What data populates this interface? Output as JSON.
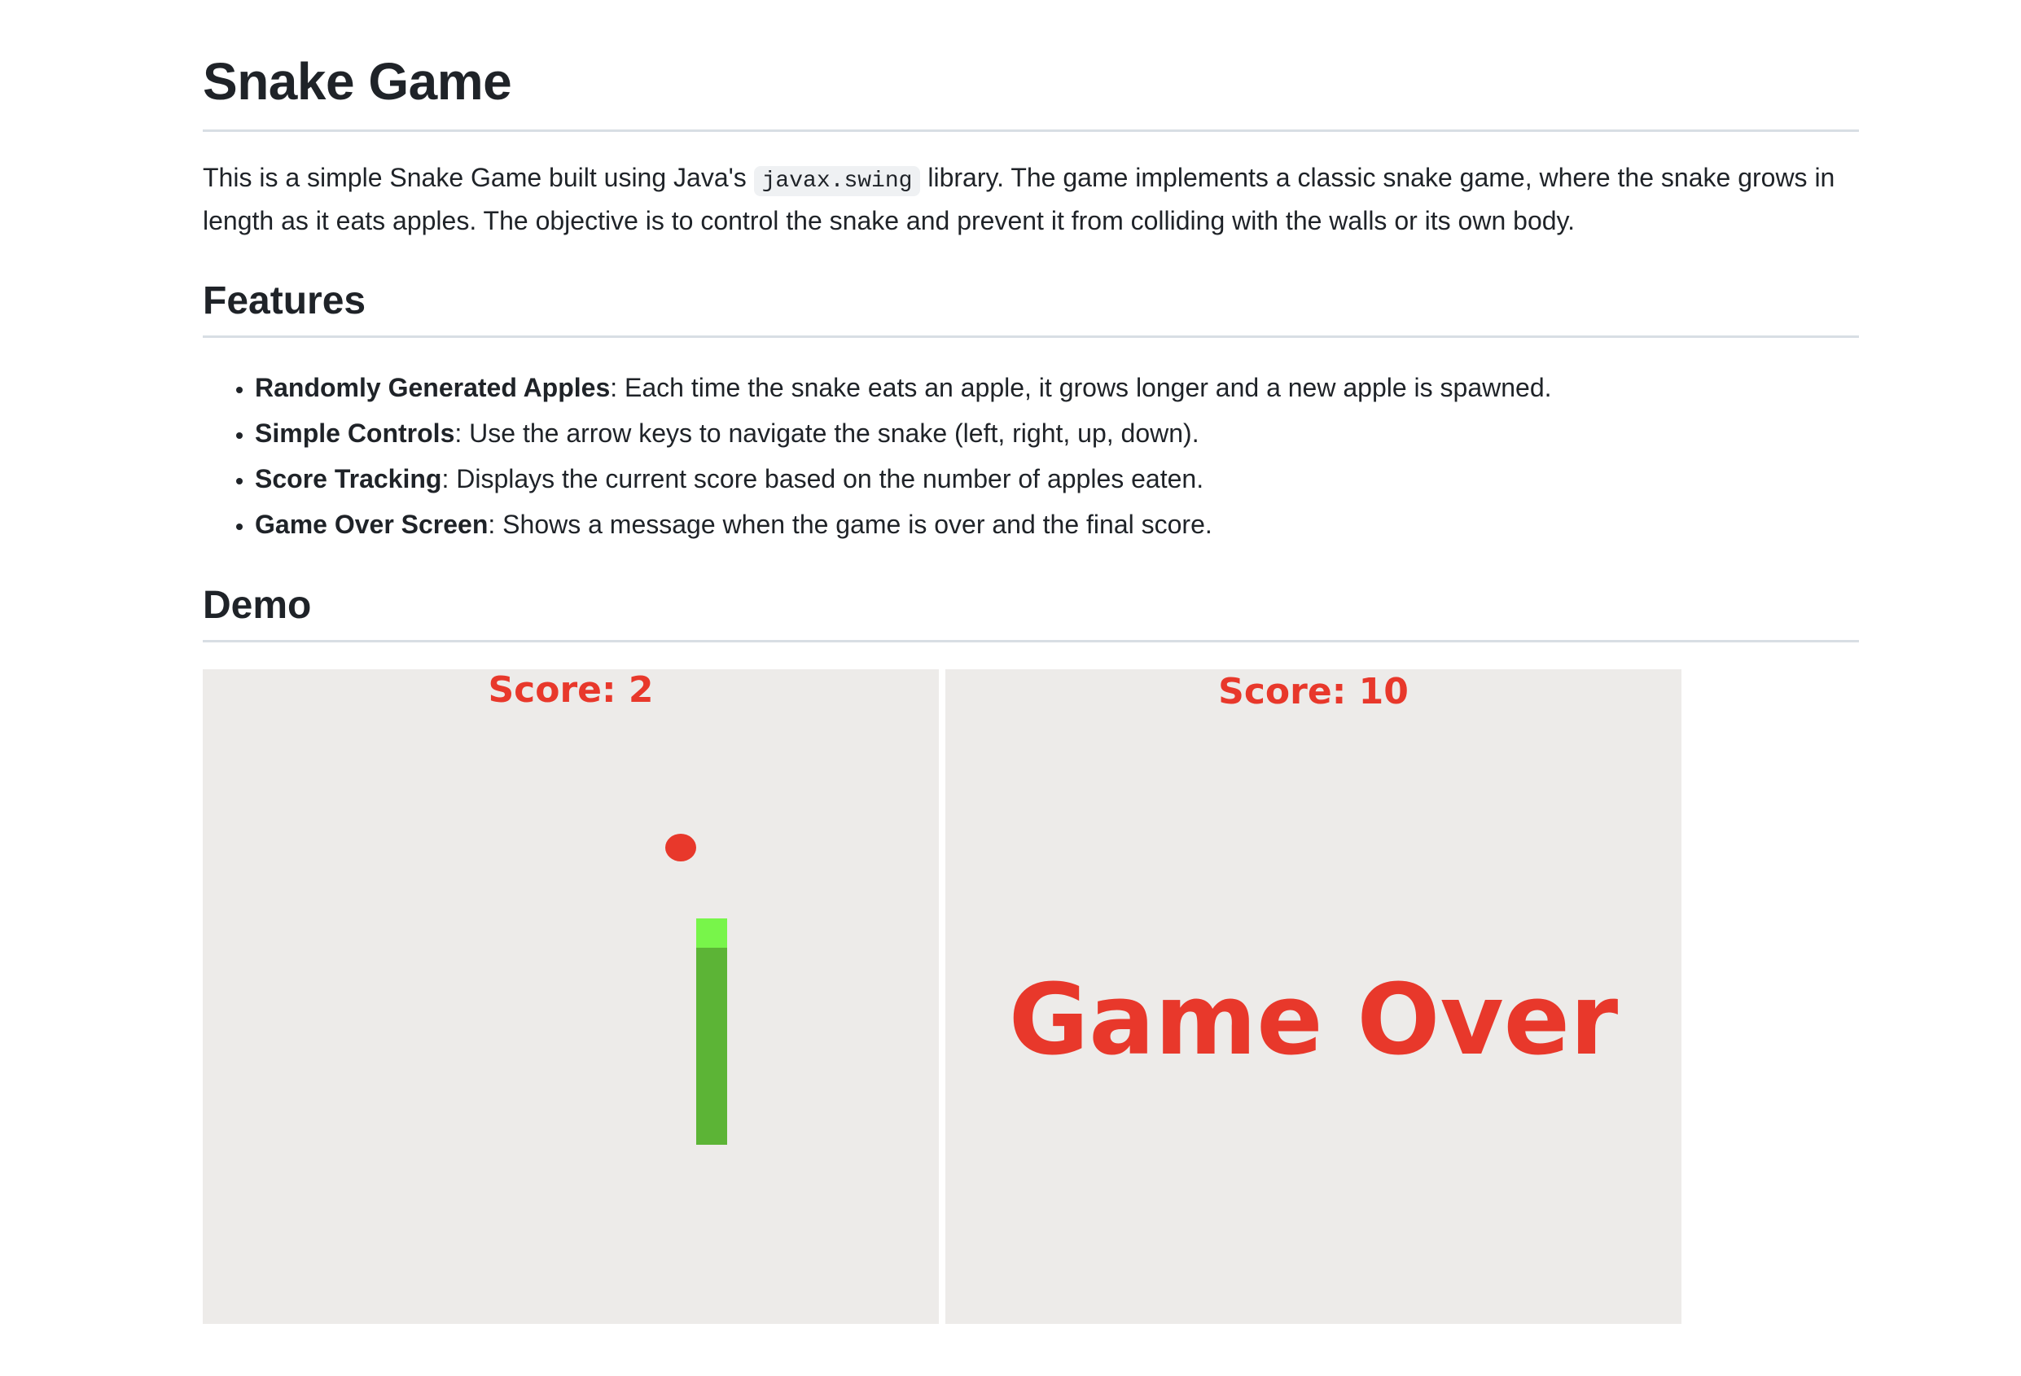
{
  "page_title": "Snake Game",
  "intro": {
    "before_code": "This is a simple Snake Game built using Java's ",
    "code": "javax.swing",
    "after_code": " library. The game implements a classic snake game, where the snake grows in length as it eats apples. The objective is to control the snake and prevent it from colliding with the walls or its own body."
  },
  "features": {
    "heading": "Features",
    "items": [
      {
        "title": "Randomly Generated Apples",
        "text": ": Each time the snake eats an apple, it grows longer and a new apple is spawned."
      },
      {
        "title": "Simple Controls",
        "text": ": Use the arrow keys to navigate the snake (left, right, up, down)."
      },
      {
        "title": "Score Tracking",
        "text": ": Displays the current score based on the number of apples eaten."
      },
      {
        "title": "Game Over Screen",
        "text": ": Shows a message when the game is over and the final score."
      }
    ]
  },
  "demo": {
    "heading": "Demo",
    "screens": [
      {
        "score_text": "Score: 2"
      },
      {
        "score_text": "Score: 10",
        "message": "Game Over"
      }
    ]
  },
  "colors": {
    "score_red": "#e8382b",
    "snake_head": "#78f54a",
    "snake_body": "#5cb436",
    "game_background": "#edebe9"
  }
}
